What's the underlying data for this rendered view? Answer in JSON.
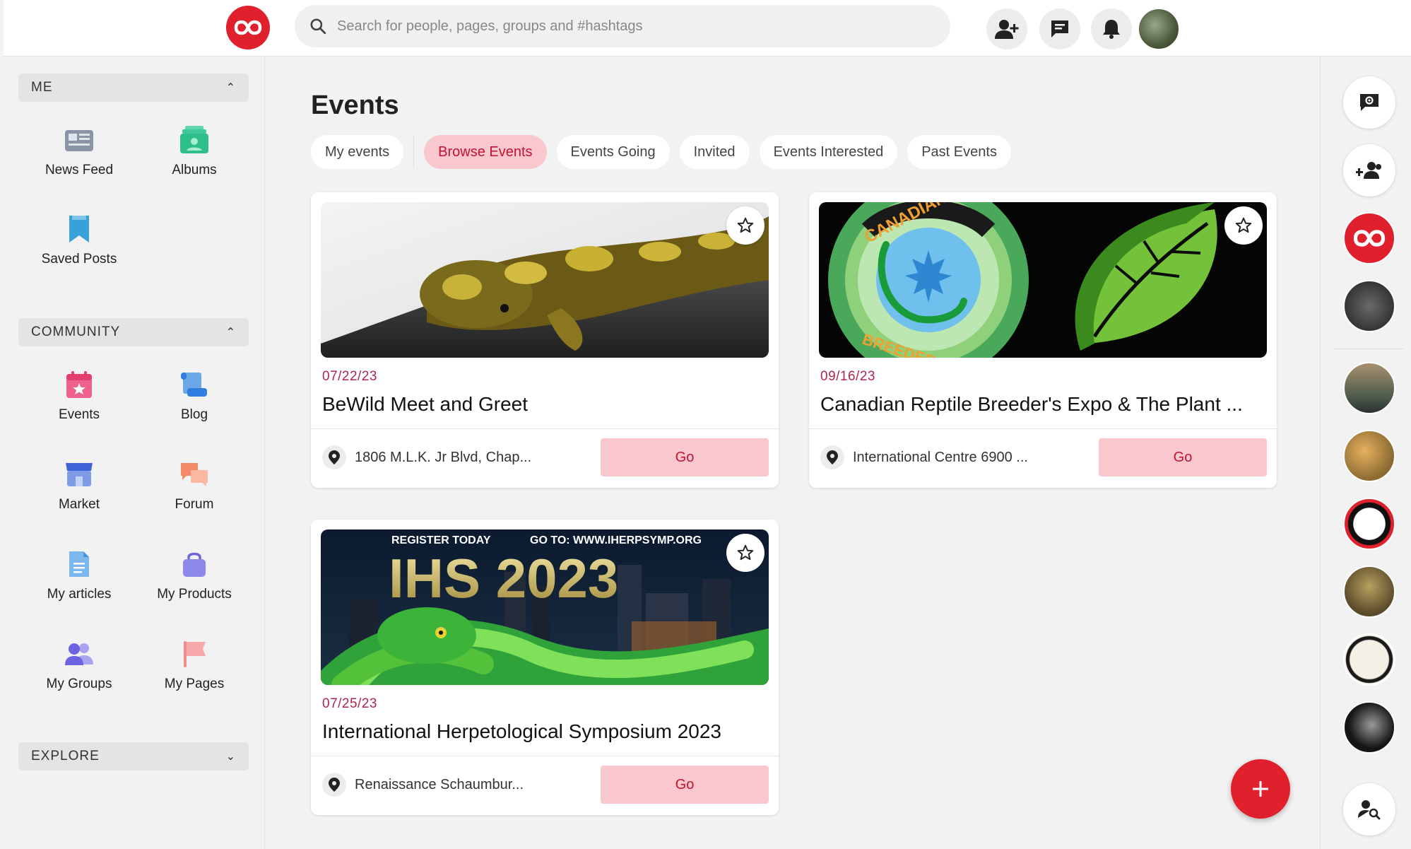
{
  "colors": {
    "brand": "#e0202c",
    "accent_text": "#c4122f",
    "accent_bg": "#f9c8cf",
    "date": "#b0264b"
  },
  "topbar": {
    "search_placeholder": "Search for people, pages, groups and #hashtags",
    "icons": [
      "add-friend-icon",
      "messages-icon",
      "notifications-icon"
    ]
  },
  "sidebar": {
    "me": {
      "label": "ME",
      "items": [
        {
          "label": "News Feed",
          "icon": "newspaper-icon"
        },
        {
          "label": "Albums",
          "icon": "albums-icon"
        },
        {
          "label": "Saved Posts",
          "icon": "bookmark-icon"
        }
      ]
    },
    "community": {
      "label": "COMMUNITY",
      "items": [
        {
          "label": "Events",
          "icon": "calendar-icon"
        },
        {
          "label": "Blog",
          "icon": "scroll-icon"
        },
        {
          "label": "Market",
          "icon": "store-icon"
        },
        {
          "label": "Forum",
          "icon": "chat-bubbles-icon"
        },
        {
          "label": "My articles",
          "icon": "document-icon"
        },
        {
          "label": "My Products",
          "icon": "shopping-bag-icon"
        },
        {
          "label": "My Groups",
          "icon": "group-icon"
        },
        {
          "label": "My Pages",
          "icon": "flag-icon"
        }
      ]
    },
    "explore": {
      "label": "EXPLORE"
    }
  },
  "main": {
    "title": "Events",
    "tabs": [
      "My events",
      "Browse Events",
      "Events Going",
      "Invited",
      "Events Interested",
      "Past Events"
    ],
    "active_tab": "Browse Events",
    "events": [
      {
        "date": "07/22/23",
        "title": "BeWild Meet and Greet",
        "location": "1806 M.L.K. Jr Blvd, Chap...",
        "go": "Go"
      },
      {
        "date": "09/16/23",
        "title": "Canadian Reptile Breeder's Expo & The Plant ...",
        "location": "International Centre 6900 ...",
        "go": "Go",
        "banner_text": [
          "CANADIAN REPTILE",
          "BREEDERS EXPO"
        ]
      },
      {
        "date": "07/25/23",
        "title": "International Herpetological Symposium 2023",
        "location": "Renaissance Schaumbur...",
        "go": "Go",
        "banner_text": [
          "REGISTER TODAY",
          "GO TO: WWW.IHERPSYMP.ORG",
          "IHS 2023"
        ]
      }
    ]
  }
}
